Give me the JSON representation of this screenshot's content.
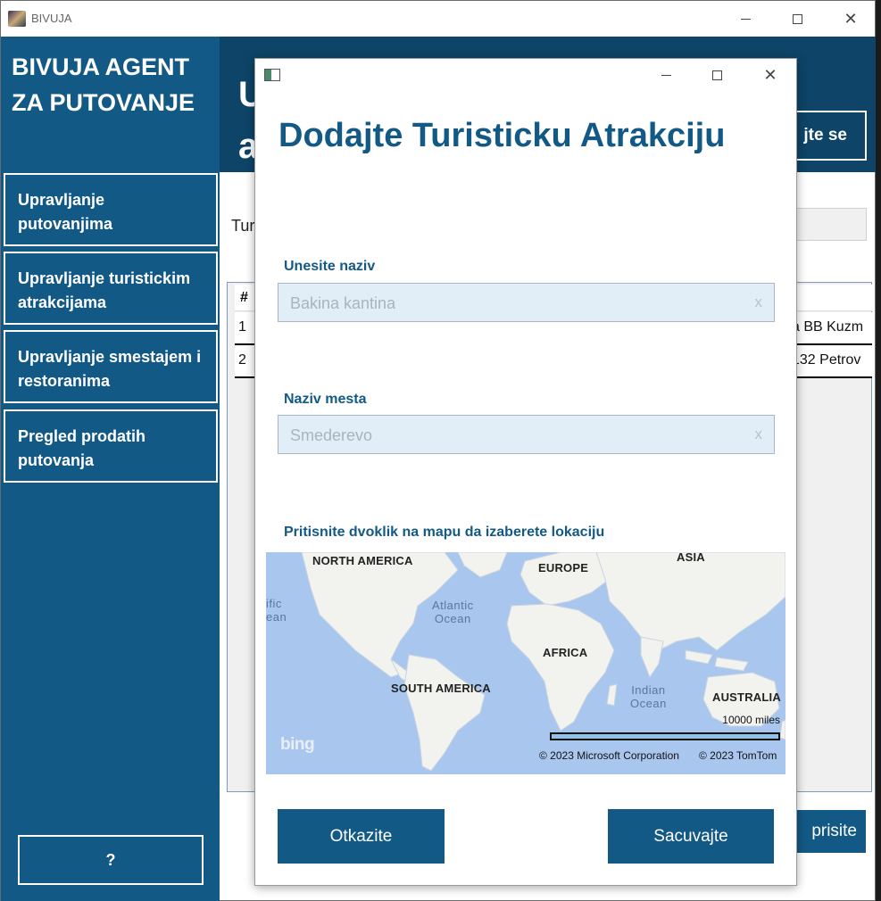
{
  "window": {
    "title": "BIVUJA"
  },
  "sidebar": {
    "brand": "BIVUJA AGENT ZA PUTOVANJE",
    "items": [
      {
        "label": "Upravljanje putovanjima"
      },
      {
        "label": "Upravljanje turistickim atrakcijama"
      },
      {
        "label": "Upravljanje smestajem i restoranima"
      },
      {
        "label": "Pregled prodatih putovanja"
      }
    ],
    "help_label": "?"
  },
  "main": {
    "header_title_partial": "U a",
    "logout_label": "jte se",
    "search_label_partial": "Tur",
    "grid": {
      "header_num": "#",
      "rows": [
        {
          "num": "1",
          "address_partial": "a BB Kuzm"
        },
        {
          "num": "2",
          "address_partial": "132 Petrov"
        }
      ]
    },
    "edit_label": "prisite"
  },
  "dialog": {
    "heading": "Dodajte Turisticku Atrakciju",
    "name_label": "Unesite naziv",
    "name_value": "Bakina kantina",
    "place_label": "Naziv mesta",
    "place_value": "Smederevo",
    "clear_glyph": "x",
    "map_instruction": "Pritisnite dvoklik na mapu da izaberete lokaciju",
    "map": {
      "labels": {
        "north_america": "NORTH AMERICA",
        "europe": "EUROPE",
        "asia": "ASIA",
        "africa": "AFRICA",
        "south_america": "SOUTH AMERICA",
        "australia": "AUSTRALIA",
        "pacific_partial": "ific\nean",
        "atlantic": "Atlantic\nOcean",
        "indian": "Indian\nOcean"
      },
      "scale": "10000 miles",
      "copyright_ms": "© 2023 Microsoft Corporation",
      "copyright_tomtom": "© 2023 TomTom",
      "logo": "bing",
      "water_color": "#a9c7ee",
      "land_color": "#f2f2ef"
    },
    "cancel_label": "Otkazite",
    "save_label": "Sacuvajte"
  },
  "colors": {
    "primary": "#135986",
    "header": "#0d4467"
  }
}
